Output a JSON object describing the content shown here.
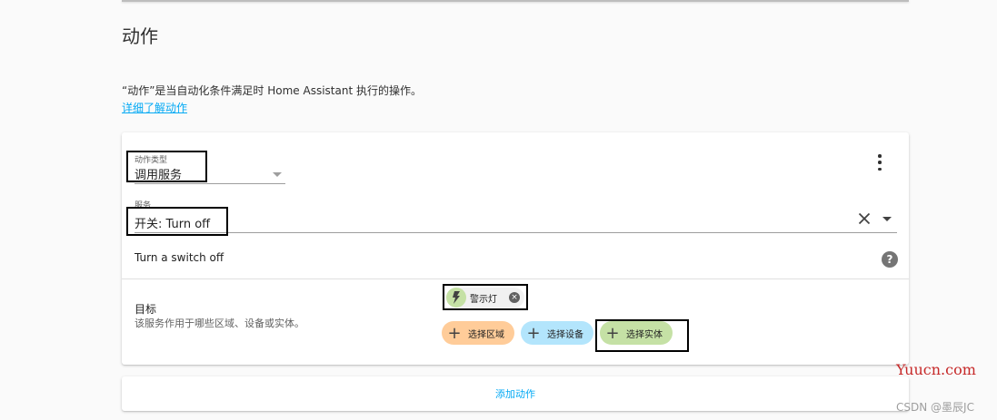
{
  "section": {
    "title": "动作",
    "description": "“动作”是当自动化条件满足时 Home Assistant 执行的操作。",
    "learn_more": "详细了解动作"
  },
  "action_card": {
    "type_field": {
      "label": "动作类型",
      "value": "调用服务"
    },
    "service_field": {
      "label": "服务",
      "value": "开关: Turn off"
    },
    "service_description": "Turn a switch off",
    "help_icon_text": "?",
    "target": {
      "title": "目标",
      "description": "该服务作用于哪些区域、设备或实体。",
      "selected_entity": {
        "label": "警示灯",
        "icon": "lightning-bolt-icon"
      },
      "pickers": [
        {
          "label": "选择区域",
          "color": "#ffcc99"
        },
        {
          "label": "选择设备",
          "color": "#b3e5fc"
        },
        {
          "label": "选择实体",
          "color": "#c5e1a5"
        }
      ]
    }
  },
  "add_action": "添加动作",
  "watermarks": {
    "site": "Yuucn.com",
    "author": "CSDN @墨辰JC"
  },
  "colors": {
    "accent": "#03a9f4",
    "annotation": "#000000",
    "watermark_site": "#c62828"
  }
}
